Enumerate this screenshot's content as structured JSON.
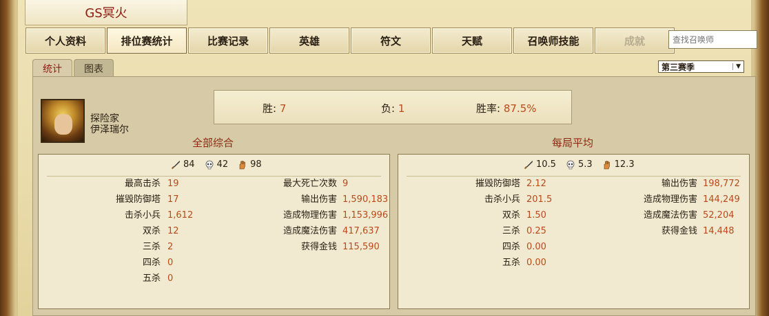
{
  "header": {
    "title": "GS冥火"
  },
  "nav": {
    "items": [
      "个人资料",
      "排位赛统计",
      "比赛记录",
      "英雄",
      "符文",
      "天赋",
      "召唤师技能",
      "成就"
    ],
    "active_index": 1,
    "disabled_index": 7
  },
  "search": {
    "placeholder": "查找召唤师"
  },
  "subtabs": {
    "stats": "统计",
    "chart": "图表"
  },
  "season": {
    "selected": "第三赛季"
  },
  "hero": {
    "title": "探险家",
    "name": "伊泽瑞尔"
  },
  "record": {
    "win_label": "胜:",
    "win_value": "7",
    "loss_label": "负:",
    "loss_value": "1",
    "rate_label": "胜率:",
    "rate_value": "87.5%"
  },
  "overall": {
    "title": "全部综合",
    "kills": "84",
    "deaths": "42",
    "assists": "98",
    "left": [
      {
        "label": "最高击杀",
        "value": "19"
      },
      {
        "label": "摧毁防御塔",
        "value": "17"
      },
      {
        "label": "击杀小兵",
        "value": "1,612"
      },
      {
        "label": "双杀",
        "value": "12"
      },
      {
        "label": "三杀",
        "value": "2"
      },
      {
        "label": "四杀",
        "value": "0"
      },
      {
        "label": "五杀",
        "value": "0"
      }
    ],
    "right": [
      {
        "label": "最大死亡次数",
        "value": "9"
      },
      {
        "label": "输出伤害",
        "value": "1,590,183"
      },
      {
        "label": "造成物理伤害",
        "value": "1,153,996"
      },
      {
        "label": "造成魔法伤害",
        "value": "417,637"
      },
      {
        "label": "获得金钱",
        "value": "115,590"
      }
    ]
  },
  "average": {
    "title": "每局平均",
    "kills": "10.5",
    "deaths": "5.3",
    "assists": "12.3",
    "left": [
      {
        "label": "摧毁防御塔",
        "value": "2.12"
      },
      {
        "label": "击杀小兵",
        "value": "201.5"
      },
      {
        "label": "双杀",
        "value": "1.50"
      },
      {
        "label": "三杀",
        "value": "0.25"
      },
      {
        "label": "四杀",
        "value": "0.00"
      },
      {
        "label": "五杀",
        "value": "0.00"
      }
    ],
    "right": [
      {
        "label": "输出伤害",
        "value": "198,772"
      },
      {
        "label": "造成物理伤害",
        "value": "144,249"
      },
      {
        "label": "造成魔法伤害",
        "value": "52,204"
      },
      {
        "label": "获得金钱",
        "value": "14,448"
      }
    ]
  },
  "icons": {
    "kills": "sword-icon",
    "deaths": "skull-icon",
    "assists": "hand-icon"
  },
  "colors": {
    "value": "#b84a1a",
    "title": "#8b1d12"
  }
}
